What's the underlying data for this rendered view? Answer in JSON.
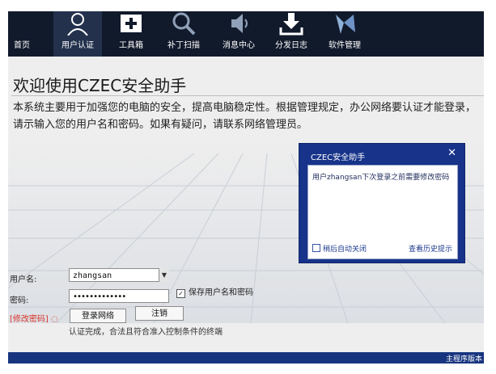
{
  "toolbar": {
    "items": [
      {
        "label": "首页",
        "icon": "home-icon"
      },
      {
        "label": "用户认证",
        "icon": "user-icon"
      },
      {
        "label": "工具箱",
        "icon": "toolbox-icon"
      },
      {
        "label": "补丁扫描",
        "icon": "search-icon"
      },
      {
        "label": "消息中心",
        "icon": "speaker-icon"
      },
      {
        "label": "分发日志",
        "icon": "download-icon"
      },
      {
        "label": "软件管理",
        "icon": "software-icon"
      }
    ],
    "active_index": 1
  },
  "main": {
    "title": "欢迎使用CZEC安全助手",
    "description": "本系统主要用于加强您的电脑的安全，提高电脑稳定性。根据管理规定，办公网络要认证才能登录，请示输入您的用户名和密码。如果有疑问，请联系网络管理员。"
  },
  "popup": {
    "title": "CZEC安全助手",
    "close": "✕",
    "message": "用户zhangsan下次登录之前需要修改密码",
    "auto_close_label": "稍后自动关闭",
    "history_link": "查看历史提示"
  },
  "login": {
    "username_label": "用户名:",
    "username_value": "zhangsan",
    "password_label": "密码:",
    "password_value": "•••••••••••••",
    "save_label": "保存用户名和密码",
    "save_checked": true,
    "change_password": "[修改密码]",
    "login_button": "登录网络",
    "logout_button": "注销",
    "status": "认证完成，合法且符合准入控制条件的终端"
  },
  "footer": {
    "text": "主程序版本"
  },
  "colors": {
    "toolbar_bg": "#111a2b",
    "popup_bg": "#17338a",
    "footer_bg": "#17357f",
    "link_red": "#d9342b"
  }
}
